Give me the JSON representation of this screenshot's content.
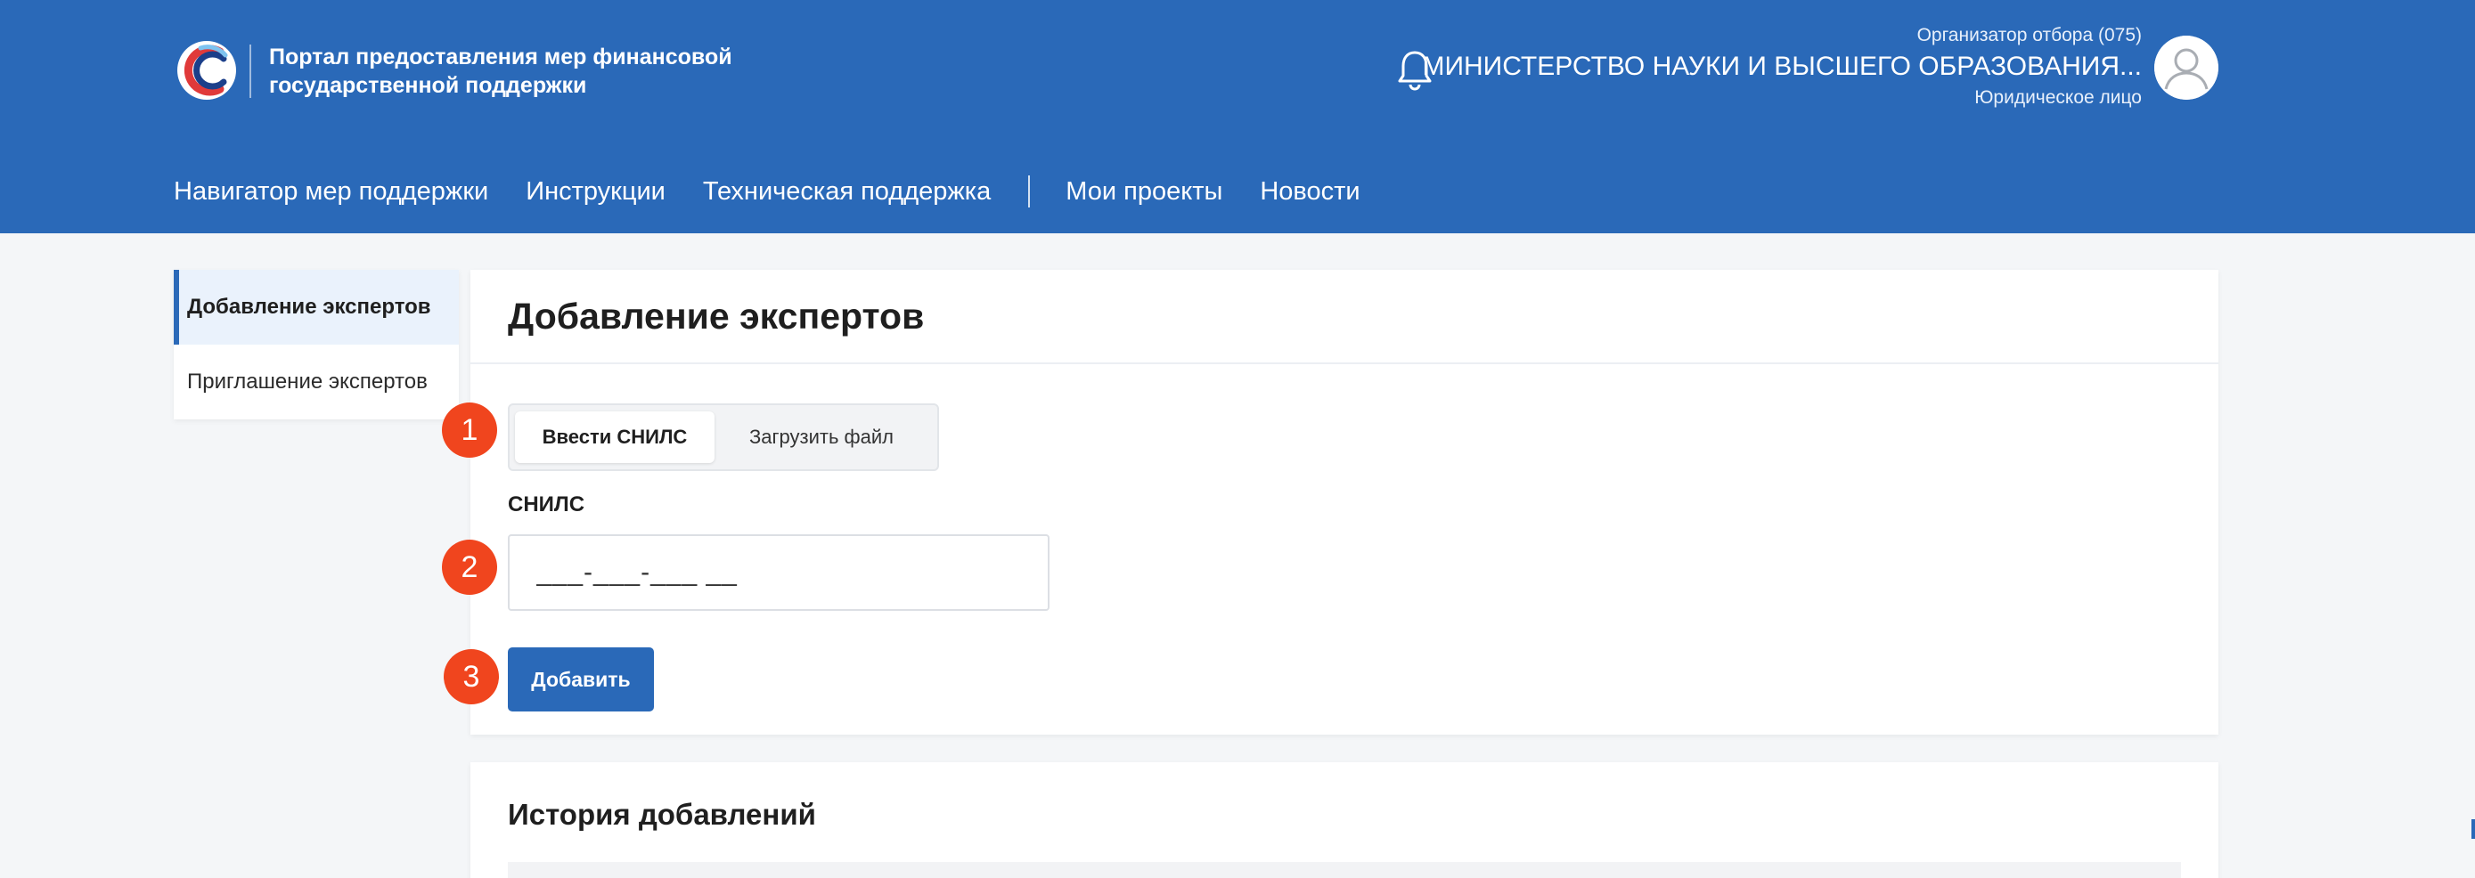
{
  "header": {
    "portal_title_line1": "Портал предоставления мер финансовой",
    "portal_title_line2": "государственной поддержки",
    "org_role": "Организатор отбора (075)",
    "org_name": "МИНИСТЕРСТВО НАУКИ И ВЫСШЕГО ОБРАЗОВАНИЯ...",
    "org_type": "Юридическое лицо",
    "nav": {
      "navigator": "Навигатор мер поддержки",
      "instructions": "Инструкции",
      "support": "Техническая поддержка",
      "my_projects": "Мои проекты",
      "news": "Новости"
    }
  },
  "sidebar": {
    "items": [
      {
        "label": "Добавление экспертов",
        "active": true
      },
      {
        "label": "Приглашение экспертов",
        "active": false
      }
    ]
  },
  "main": {
    "title": "Добавление экспертов",
    "tabs": [
      {
        "label": "Ввести СНИЛС",
        "active": true
      },
      {
        "label": "Загрузить файл",
        "active": false
      }
    ],
    "snils_label": "СНИЛС",
    "snils_placeholder": "___-___-___ __",
    "snils_value": "",
    "add_button": "Добавить",
    "markers": [
      "1",
      "2",
      "3"
    ]
  },
  "history": {
    "title": "История добавлений"
  },
  "colors": {
    "brand": "#2a69b8",
    "marker": "#f0451e",
    "background": "#f4f6f8"
  },
  "icons": {
    "logo": "portal-logo",
    "bell": "bell-icon",
    "avatar": "user-avatar-icon"
  }
}
